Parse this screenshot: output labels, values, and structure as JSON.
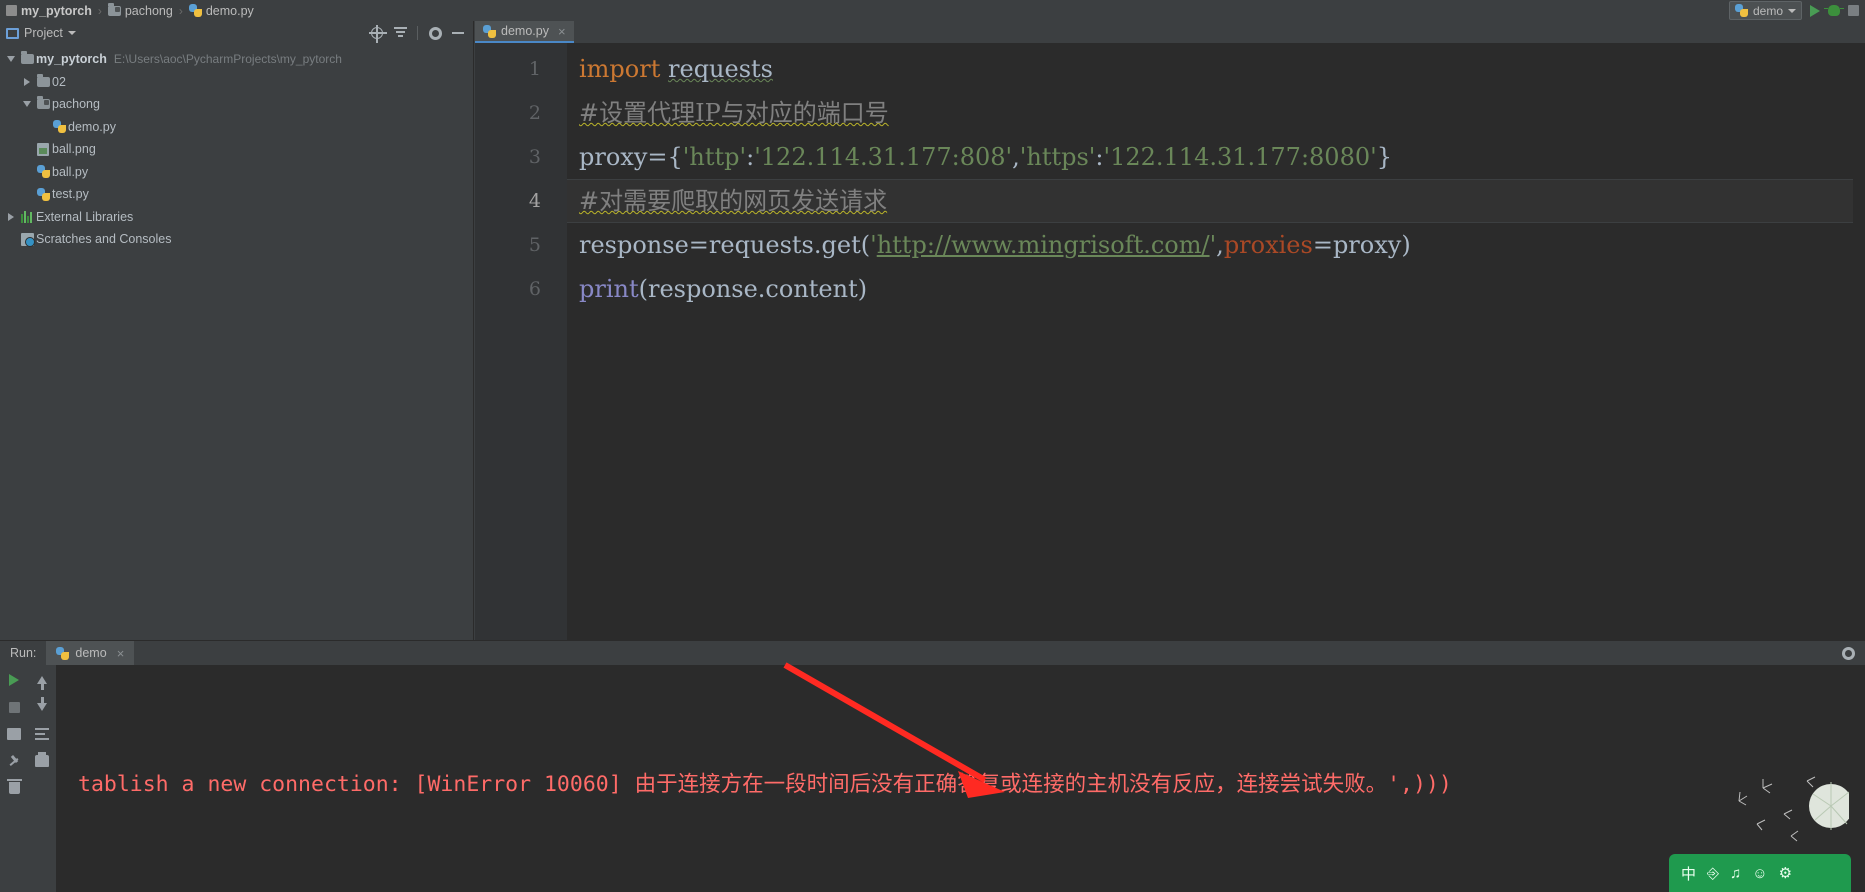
{
  "breadcrumb": {
    "items": [
      {
        "label": "my_pytorch",
        "icon": "module-icon",
        "bold": true
      },
      {
        "label": "pachong",
        "icon": "package-folder-icon",
        "bold": false
      },
      {
        "label": "demo.py",
        "icon": "python-file-icon",
        "bold": false
      }
    ],
    "separator": "›"
  },
  "run_widget": {
    "config_name": "demo",
    "config_icon": "python-file-icon",
    "dropdown_icon": "chevron-down-icon",
    "run_icon": "run-triangle-icon",
    "debug_icon": "debug-bug-icon",
    "stop_icon": "stop-square-icon"
  },
  "project_panel": {
    "title": "Project",
    "window_icon": "project-window-icon",
    "dropdown_icon": "chevron-down-icon",
    "buttons": [
      {
        "name": "locate-in-tree-icon",
        "label": ""
      },
      {
        "name": "collapse-all-icon",
        "label": ""
      },
      {
        "name": "settings-gear-icon",
        "label": ""
      },
      {
        "name": "hide-panel-icon",
        "label": ""
      }
    ],
    "tree": [
      {
        "label": "my_pytorch",
        "path": "E:\\Users\\aoc\\PycharmProjects\\my_pytorch",
        "indent": 0,
        "arrow": "down",
        "icon": "folder-icon",
        "bold": true
      },
      {
        "label": "02",
        "path": "",
        "indent": 1,
        "arrow": "right",
        "icon": "folder-icon",
        "bold": false
      },
      {
        "label": "pachong",
        "path": "",
        "indent": 1,
        "arrow": "down",
        "icon": "package-folder-icon",
        "bold": false
      },
      {
        "label": "demo.py",
        "path": "",
        "indent": 2,
        "arrow": "none",
        "icon": "python-file-icon",
        "bold": false
      },
      {
        "label": "ball.png",
        "path": "",
        "indent": 1,
        "arrow": "none",
        "icon": "image-file-icon",
        "bold": false
      },
      {
        "label": "ball.py",
        "path": "",
        "indent": 1,
        "arrow": "none",
        "icon": "python-file-icon",
        "bold": false
      },
      {
        "label": "test.py",
        "path": "",
        "indent": 1,
        "arrow": "none",
        "icon": "python-file-icon",
        "bold": false
      },
      {
        "label": "External Libraries",
        "path": "",
        "indent": 0,
        "arrow": "right",
        "icon": "library-icon",
        "bold": false
      },
      {
        "label": "Scratches and Consoles",
        "path": "",
        "indent": 0,
        "arrow": "none",
        "icon": "scratches-icon",
        "bold": false
      }
    ]
  },
  "editor": {
    "tab": {
      "label": "demo.py",
      "icon": "python-file-icon",
      "close": "×"
    },
    "gutter": [
      "1",
      "2",
      "3",
      "4",
      "5",
      "6"
    ],
    "active_line": 4,
    "lines": [
      {
        "n": "1",
        "tokens": [
          {
            "t": "import",
            "c": "k-kw"
          },
          {
            "t": " ",
            "c": "k-plain"
          },
          {
            "t": "requests",
            "c": "k-plain squiggle-green"
          }
        ]
      },
      {
        "n": "2",
        "tokens": [
          {
            "t": "#设置代理IP与对应的端口号",
            "c": "k-comment squiggle"
          }
        ]
      },
      {
        "n": "3",
        "tokens": [
          {
            "t": "proxy",
            "c": "k-plain"
          },
          {
            "t": "=",
            "c": "k-plain"
          },
          {
            "t": "{",
            "c": "k-brace"
          },
          {
            "t": "'http'",
            "c": "k-str"
          },
          {
            "t": ":",
            "c": "k-plain"
          },
          {
            "t": "'122.114.31.177:808'",
            "c": "k-str"
          },
          {
            "t": ",",
            "c": "k-plain"
          },
          {
            "t": "'https'",
            "c": "k-str"
          },
          {
            "t": ":",
            "c": "k-plain"
          },
          {
            "t": "'122.114.31.177:8080'",
            "c": "k-str"
          },
          {
            "t": "}",
            "c": "k-brace"
          }
        ]
      },
      {
        "n": "4",
        "tokens": [
          {
            "t": "#对需要爬取的网页发送请求",
            "c": "k-comment squiggle"
          }
        ]
      },
      {
        "n": "5",
        "tokens": [
          {
            "t": "response",
            "c": "k-plain"
          },
          {
            "t": "=",
            "c": "k-plain"
          },
          {
            "t": "requests",
            "c": "k-plain"
          },
          {
            "t": ".",
            "c": "k-plain"
          },
          {
            "t": "get",
            "c": "k-plain"
          },
          {
            "t": "(",
            "c": "k-brace"
          },
          {
            "t": "'",
            "c": "k-str"
          },
          {
            "t": "http://www.mingrisoft.com/",
            "c": "urlink"
          },
          {
            "t": "'",
            "c": "k-str"
          },
          {
            "t": ",",
            "c": "k-plain"
          },
          {
            "t": "proxies",
            "c": "k-kwarg"
          },
          {
            "t": "=",
            "c": "k-plain"
          },
          {
            "t": "proxy",
            "c": "k-plain"
          },
          {
            "t": ")",
            "c": "k-brace"
          }
        ]
      },
      {
        "n": "6",
        "tokens": [
          {
            "t": "print",
            "c": "k-func"
          },
          {
            "t": "(",
            "c": "k-brace"
          },
          {
            "t": "response",
            "c": "k-plain"
          },
          {
            "t": ".",
            "c": "k-plain"
          },
          {
            "t": "content",
            "c": "k-plain"
          },
          {
            "t": ")",
            "c": "k-brace"
          }
        ]
      }
    ]
  },
  "run_panel": {
    "label": "Run:",
    "tab": {
      "label": "demo",
      "icon": "python-file-icon",
      "close": "×"
    },
    "gear_icon": "settings-gear-icon",
    "toolbar": [
      {
        "name": "rerun-icon"
      },
      {
        "name": "scroll-up-icon"
      },
      {
        "name": "stop-icon"
      },
      {
        "name": "scroll-down-icon"
      },
      {
        "name": "toggle-tasks-icon"
      },
      {
        "name": "soft-wrap-icon"
      },
      {
        "name": "pin-tab-icon"
      },
      {
        "name": "print-icon"
      },
      {
        "name": "clear-all-icon"
      }
    ],
    "console_output": "tablish a new connection: [WinError 10060] 由于连接方在一段时间后没有正确答复或连接的主机没有反应，连接尝试失败。',)))",
    "console_color": "#ff6b68",
    "annotation_arrow_color": "#ff2a22"
  },
  "ime_bar": {
    "mode_label": "中",
    "icons": [
      "ime-mode-icon",
      "ime-keyboard-icon",
      "ime-voice-icon",
      "ime-emoji-icon",
      "ime-settings-icon"
    ],
    "background": "#1f9a4e"
  }
}
